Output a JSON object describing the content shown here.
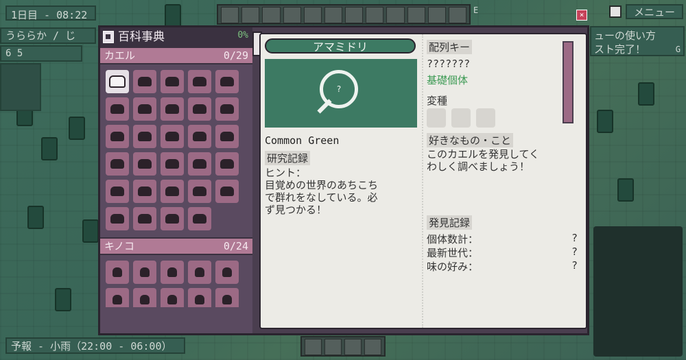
{
  "hud": {
    "day_time": "1日目 - 08:22",
    "weather": "うららか / じ",
    "stats": "6 5",
    "menu_label": "メニュー",
    "quest_line1": "ューの使い方",
    "quest_line2": "スト完了！",
    "quest_key": "G",
    "tool_key": "E",
    "forecast": "予報 - 小雨（22:00 - 06:00）"
  },
  "sidebar": {
    "title": "百科事典",
    "percent": "0%",
    "categories": [
      {
        "name": "カエル",
        "count": "0/29"
      },
      {
        "name": "キノコ",
        "count": "0/24"
      }
    ]
  },
  "entry": {
    "name": "アマミドリ",
    "portrait_mark": "?",
    "english_name": "Common Green",
    "research_label": "研究記録",
    "hint": "ヒント：\n目覚めの世界のあちこち\nで群れをなしている。必\nず見つかる！",
    "sequence_label": "配列キー",
    "sequence_value": "???????",
    "base_label": "基礎個体",
    "variant_label": "変種",
    "likes_label": "好きなもの・こと",
    "likes_text": "このカエルを発見してく\nわしく調べましょう！",
    "discovery_label": "発見記録",
    "records": [
      {
        "label": "個体数計：",
        "value": "?"
      },
      {
        "label": "最新世代：",
        "value": "?"
      },
      {
        "label": "味の好み：",
        "value": "?"
      }
    ]
  },
  "colors": {
    "accent_green": "#3d7a63",
    "category_pink": "#b07a95",
    "page_bg": "#ecebe6"
  }
}
